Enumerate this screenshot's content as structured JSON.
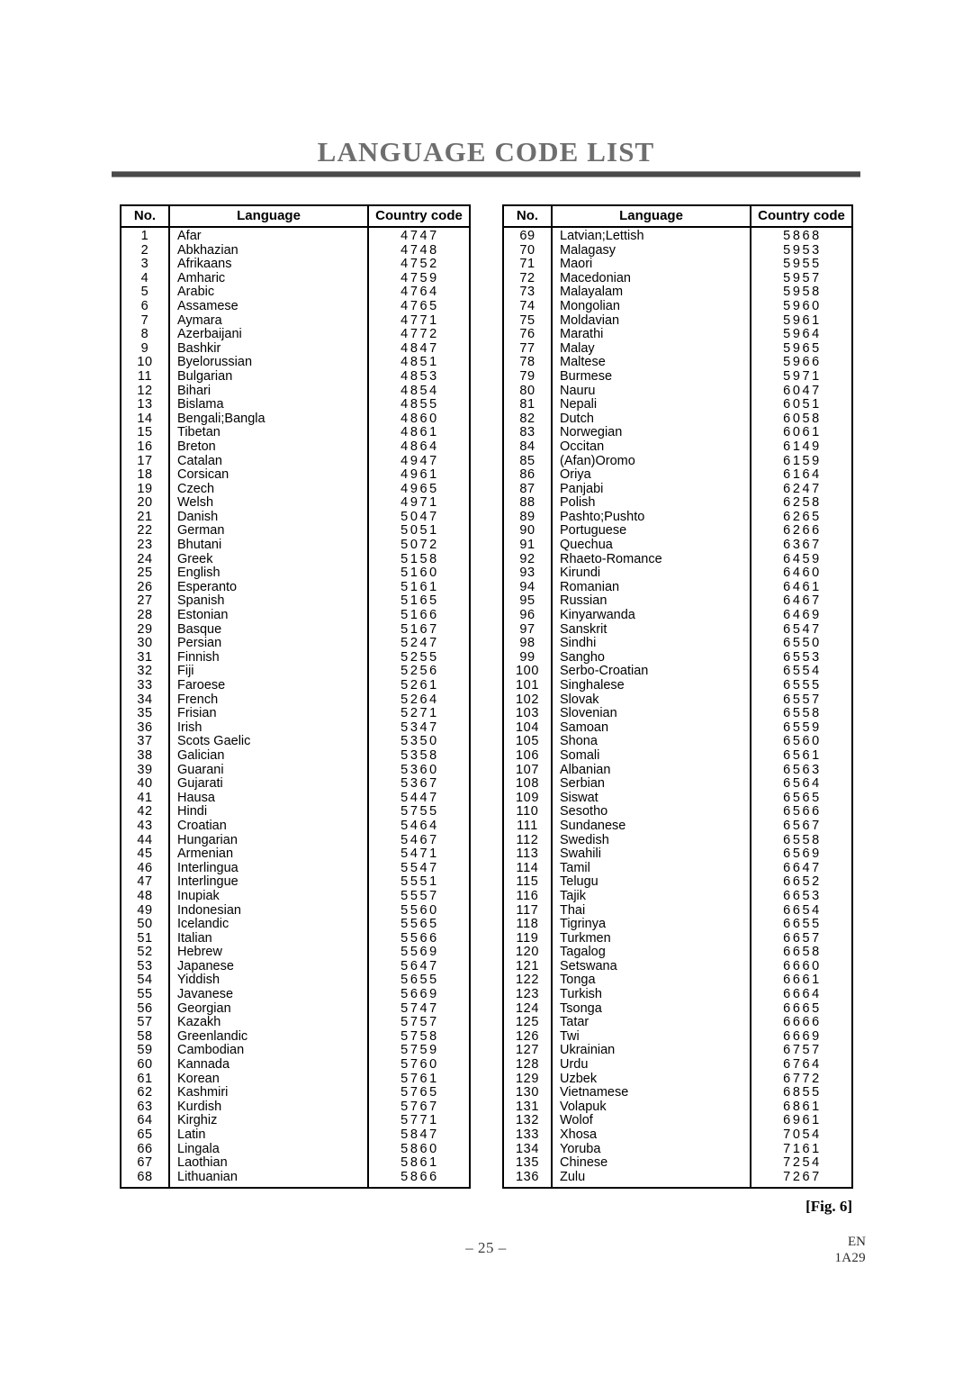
{
  "document": {
    "title": "LANGUAGE CODE LIST",
    "figure_caption": "[Fig. 6]",
    "page_number": "– 25 –",
    "footer_language": "EN",
    "footer_code": "1A29"
  },
  "table": {
    "headers": {
      "no": "No.",
      "language": "Language",
      "country_code": "Country code"
    },
    "left_column": [
      {
        "no": "1",
        "language": "Afar",
        "code": "4747"
      },
      {
        "no": "2",
        "language": "Abkhazian",
        "code": "4748"
      },
      {
        "no": "3",
        "language": "Afrikaans",
        "code": "4752"
      },
      {
        "no": "4",
        "language": "Amharic",
        "code": "4759"
      },
      {
        "no": "5",
        "language": "Arabic",
        "code": "4764"
      },
      {
        "no": "6",
        "language": "Assamese",
        "code": "4765"
      },
      {
        "no": "7",
        "language": "Aymara",
        "code": "4771"
      },
      {
        "no": "8",
        "language": "Azerbaijani",
        "code": "4772"
      },
      {
        "no": "9",
        "language": "Bashkir",
        "code": "4847"
      },
      {
        "no": "10",
        "language": "Byelorussian",
        "code": "4851"
      },
      {
        "no": "11",
        "language": "Bulgarian",
        "code": "4853"
      },
      {
        "no": "12",
        "language": "Bihari",
        "code": "4854"
      },
      {
        "no": "13",
        "language": "Bislama",
        "code": "4855"
      },
      {
        "no": "14",
        "language": "Bengali;Bangla",
        "code": "4860"
      },
      {
        "no": "15",
        "language": "Tibetan",
        "code": "4861"
      },
      {
        "no": "16",
        "language": "Breton",
        "code": "4864"
      },
      {
        "no": "17",
        "language": "Catalan",
        "code": "4947"
      },
      {
        "no": "18",
        "language": "Corsican",
        "code": "4961"
      },
      {
        "no": "19",
        "language": "Czech",
        "code": "4965"
      },
      {
        "no": "20",
        "language": "Welsh",
        "code": "4971"
      },
      {
        "no": "21",
        "language": "Danish",
        "code": "5047"
      },
      {
        "no": "22",
        "language": "German",
        "code": "5051"
      },
      {
        "no": "23",
        "language": "Bhutani",
        "code": "5072"
      },
      {
        "no": "24",
        "language": "Greek",
        "code": "5158"
      },
      {
        "no": "25",
        "language": "English",
        "code": "5160"
      },
      {
        "no": "26",
        "language": "Esperanto",
        "code": "5161"
      },
      {
        "no": "27",
        "language": "Spanish",
        "code": "5165"
      },
      {
        "no": "28",
        "language": "Estonian",
        "code": "5166"
      },
      {
        "no": "29",
        "language": "Basque",
        "code": "5167"
      },
      {
        "no": "30",
        "language": "Persian",
        "code": "5247"
      },
      {
        "no": "31",
        "language": "Finnish",
        "code": "5255"
      },
      {
        "no": "32",
        "language": "Fiji",
        "code": "5256"
      },
      {
        "no": "33",
        "language": "Faroese",
        "code": "5261"
      },
      {
        "no": "34",
        "language": "French",
        "code": "5264"
      },
      {
        "no": "35",
        "language": "Frisian",
        "code": "5271"
      },
      {
        "no": "36",
        "language": "Irish",
        "code": "5347"
      },
      {
        "no": "37",
        "language": "Scots Gaelic",
        "code": "5350"
      },
      {
        "no": "38",
        "language": "Galician",
        "code": "5358"
      },
      {
        "no": "39",
        "language": "Guarani",
        "code": "5360"
      },
      {
        "no": "40",
        "language": "Gujarati",
        "code": "5367"
      },
      {
        "no": "41",
        "language": "Hausa",
        "code": "5447"
      },
      {
        "no": "42",
        "language": "Hindi",
        "code": "5755"
      },
      {
        "no": "43",
        "language": "Croatian",
        "code": "5464"
      },
      {
        "no": "44",
        "language": "Hungarian",
        "code": "5467"
      },
      {
        "no": "45",
        "language": "Armenian",
        "code": "5471"
      },
      {
        "no": "46",
        "language": "Interlingua",
        "code": "5547"
      },
      {
        "no": "47",
        "language": "Interlingue",
        "code": "5551"
      },
      {
        "no": "48",
        "language": "Inupiak",
        "code": "5557"
      },
      {
        "no": "49",
        "language": "Indonesian",
        "code": "5560"
      },
      {
        "no": "50",
        "language": "Icelandic",
        "code": "5565"
      },
      {
        "no": "51",
        "language": "Italian",
        "code": "5566"
      },
      {
        "no": "52",
        "language": "Hebrew",
        "code": "5569"
      },
      {
        "no": "53",
        "language": "Japanese",
        "code": "5647"
      },
      {
        "no": "54",
        "language": "Yiddish",
        "code": "5655"
      },
      {
        "no": "55",
        "language": "Javanese",
        "code": "5669"
      },
      {
        "no": "56",
        "language": "Georgian",
        "code": "5747"
      },
      {
        "no": "57",
        "language": "Kazakh",
        "code": "5757"
      },
      {
        "no": "58",
        "language": "Greenlandic",
        "code": "5758"
      },
      {
        "no": "59",
        "language": "Cambodian",
        "code": "5759"
      },
      {
        "no": "60",
        "language": "Kannada",
        "code": "5760"
      },
      {
        "no": "61",
        "language": "Korean",
        "code": "5761"
      },
      {
        "no": "62",
        "language": "Kashmiri",
        "code": "5765"
      },
      {
        "no": "63",
        "language": "Kurdish",
        "code": "5767"
      },
      {
        "no": "64",
        "language": "Kirghiz",
        "code": "5771"
      },
      {
        "no": "65",
        "language": "Latin",
        "code": "5847"
      },
      {
        "no": "66",
        "language": "Lingala",
        "code": "5860"
      },
      {
        "no": "67",
        "language": "Laothian",
        "code": "5861"
      },
      {
        "no": "68",
        "language": "Lithuanian",
        "code": "5866"
      }
    ],
    "right_column": [
      {
        "no": "69",
        "language": "Latvian;Lettish",
        "code": "5868"
      },
      {
        "no": "70",
        "language": "Malagasy",
        "code": "5953"
      },
      {
        "no": "71",
        "language": "Maori",
        "code": "5955"
      },
      {
        "no": "72",
        "language": "Macedonian",
        "code": "5957"
      },
      {
        "no": "73",
        "language": "Malayalam",
        "code": "5958"
      },
      {
        "no": "74",
        "language": "Mongolian",
        "code": "5960"
      },
      {
        "no": "75",
        "language": "Moldavian",
        "code": "5961"
      },
      {
        "no": "76",
        "language": "Marathi",
        "code": "5964"
      },
      {
        "no": "77",
        "language": "Malay",
        "code": "5965"
      },
      {
        "no": "78",
        "language": "Maltese",
        "code": "5966"
      },
      {
        "no": "79",
        "language": "Burmese",
        "code": "5971"
      },
      {
        "no": "80",
        "language": "Nauru",
        "code": "6047"
      },
      {
        "no": "81",
        "language": "Nepali",
        "code": "6051"
      },
      {
        "no": "82",
        "language": "Dutch",
        "code": "6058"
      },
      {
        "no": "83",
        "language": "Norwegian",
        "code": "6061"
      },
      {
        "no": "84",
        "language": "Occitan",
        "code": "6149"
      },
      {
        "no": "85",
        "language": "(Afan)Oromo",
        "code": "6159"
      },
      {
        "no": "86",
        "language": "Oriya",
        "code": "6164"
      },
      {
        "no": "87",
        "language": "Panjabi",
        "code": "6247"
      },
      {
        "no": "88",
        "language": "Polish",
        "code": "6258"
      },
      {
        "no": "89",
        "language": "Pashto;Pushto",
        "code": "6265"
      },
      {
        "no": "90",
        "language": "Portuguese",
        "code": "6266"
      },
      {
        "no": "91",
        "language": "Quechua",
        "code": "6367"
      },
      {
        "no": "92",
        "language": "Rhaeto-Romance",
        "code": "6459"
      },
      {
        "no": "93",
        "language": "Kirundi",
        "code": "6460"
      },
      {
        "no": "94",
        "language": "Romanian",
        "code": "6461"
      },
      {
        "no": "95",
        "language": "Russian",
        "code": "6467"
      },
      {
        "no": "96",
        "language": "Kinyarwanda",
        "code": "6469"
      },
      {
        "no": "97",
        "language": "Sanskrit",
        "code": "6547"
      },
      {
        "no": "98",
        "language": "Sindhi",
        "code": "6550"
      },
      {
        "no": "99",
        "language": "Sangho",
        "code": "6553"
      },
      {
        "no": "100",
        "language": "Serbo-Croatian",
        "code": "6554"
      },
      {
        "no": "101",
        "language": "Singhalese",
        "code": "6555"
      },
      {
        "no": "102",
        "language": "Slovak",
        "code": "6557"
      },
      {
        "no": "103",
        "language": "Slovenian",
        "code": "6558"
      },
      {
        "no": "104",
        "language": "Samoan",
        "code": "6559"
      },
      {
        "no": "105",
        "language": "Shona",
        "code": "6560"
      },
      {
        "no": "106",
        "language": "Somali",
        "code": "6561"
      },
      {
        "no": "107",
        "language": "Albanian",
        "code": "6563"
      },
      {
        "no": "108",
        "language": "Serbian",
        "code": "6564"
      },
      {
        "no": "109",
        "language": "Siswat",
        "code": "6565"
      },
      {
        "no": "110",
        "language": "Sesotho",
        "code": "6566"
      },
      {
        "no": "111",
        "language": "Sundanese",
        "code": "6567"
      },
      {
        "no": "112",
        "language": "Swedish",
        "code": "6558"
      },
      {
        "no": "113",
        "language": "Swahili",
        "code": "6569"
      },
      {
        "no": "114",
        "language": "Tamil",
        "code": "6647"
      },
      {
        "no": "115",
        "language": "Telugu",
        "code": "6652"
      },
      {
        "no": "116",
        "language": "Tajik",
        "code": "6653"
      },
      {
        "no": "117",
        "language": "Thai",
        "code": "6654"
      },
      {
        "no": "118",
        "language": "Tigrinya",
        "code": "6655"
      },
      {
        "no": "119",
        "language": "Turkmen",
        "code": "6657"
      },
      {
        "no": "120",
        "language": "Tagalog",
        "code": "6658"
      },
      {
        "no": "121",
        "language": "Setswana",
        "code": "6660"
      },
      {
        "no": "122",
        "language": "Tonga",
        "code": "6661"
      },
      {
        "no": "123",
        "language": "Turkish",
        "code": "6664"
      },
      {
        "no": "124",
        "language": "Tsonga",
        "code": "6665"
      },
      {
        "no": "125",
        "language": "Tatar",
        "code": "6666"
      },
      {
        "no": "126",
        "language": "Twi",
        "code": "6669"
      },
      {
        "no": "127",
        "language": "Ukrainian",
        "code": "6757"
      },
      {
        "no": "128",
        "language": "Urdu",
        "code": "6764"
      },
      {
        "no": "129",
        "language": "Uzbek",
        "code": "6772"
      },
      {
        "no": "130",
        "language": "Vietnamese",
        "code": "6855"
      },
      {
        "no": "131",
        "language": "Volapuk",
        "code": "6861"
      },
      {
        "no": "132",
        "language": "Wolof",
        "code": "6961"
      },
      {
        "no": "133",
        "language": "Xhosa",
        "code": "7054"
      },
      {
        "no": "134",
        "language": "Yoruba",
        "code": "7161"
      },
      {
        "no": "135",
        "language": "Chinese",
        "code": "7254"
      },
      {
        "no": "136",
        "language": "Zulu",
        "code": "7267"
      }
    ]
  }
}
